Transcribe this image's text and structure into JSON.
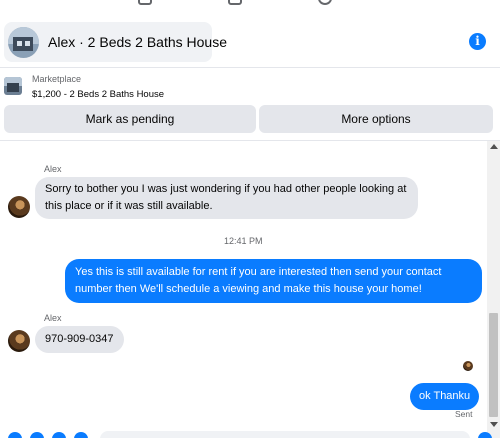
{
  "header": {
    "title": "Alex · 2 Beds 2 Baths House",
    "avatar_icon": "house-photo",
    "info_icon": "info-icon",
    "info_glyph": "i"
  },
  "marketplace": {
    "label": "Marketplace",
    "listing": "$1,200 - 2 Beds 2 Baths House"
  },
  "actions": {
    "mark_pending": "Mark as pending",
    "more_options": "More options"
  },
  "conversation": {
    "sender_1": "Alex",
    "message_1": "Sorry to bother you I was just wondering if you had other people looking at this place or if it was still available.",
    "timestamp": "12:41 PM",
    "message_2": "Yes this is still available for rent  if you are interested then send your contact number then We'll schedule a viewing and make this house your home!",
    "sender_2": "Alex",
    "message_3": "970-909-0347",
    "message_4": "ok Thanku",
    "status": "Sent"
  },
  "colors": {
    "accent": "#0a7cff",
    "incoming_bubble": "#e4e6eb",
    "secondary_text": "#65676b"
  }
}
